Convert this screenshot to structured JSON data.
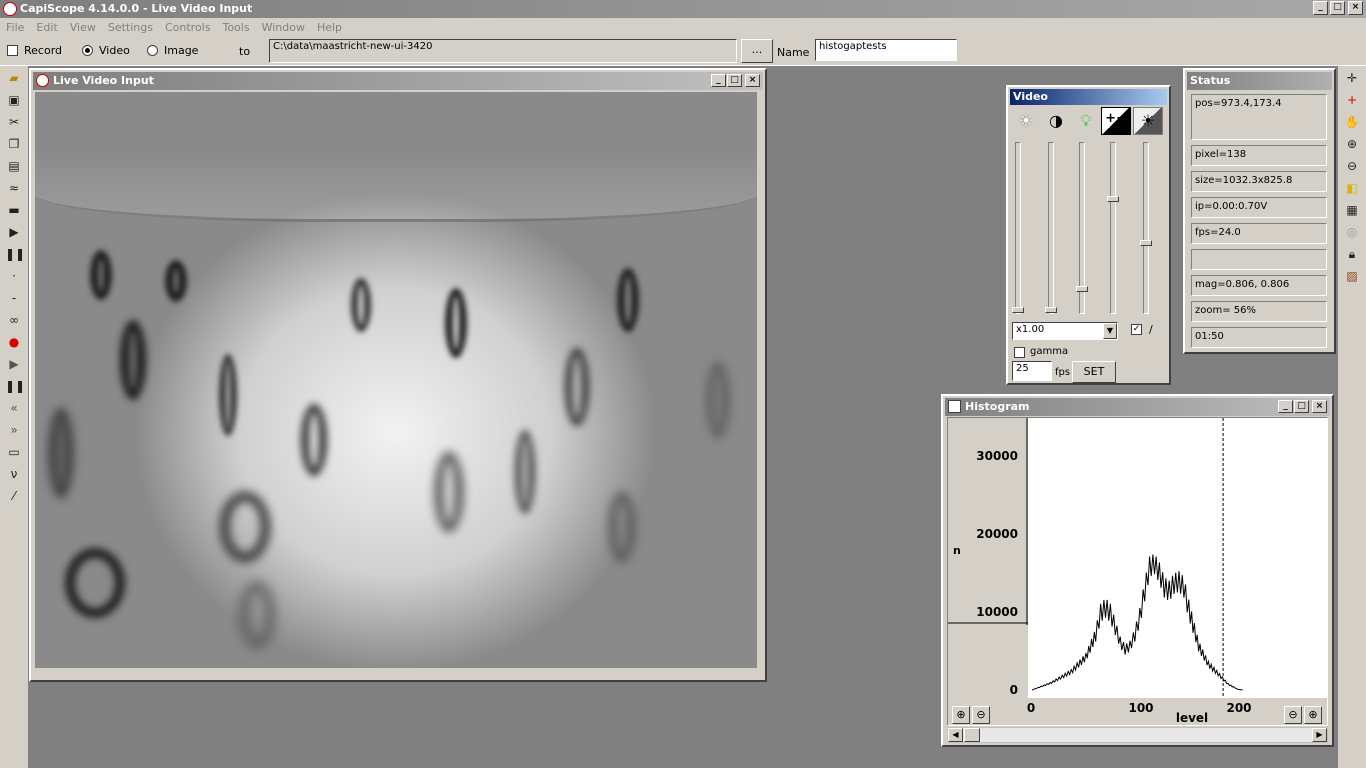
{
  "app": {
    "title": "CapiScope 4.14.0.0 - Live Video Input",
    "logo_icon": "capiscope-logo-icon"
  },
  "menu": [
    "File",
    "Edit",
    "View",
    "Settings",
    "Controls",
    "Tools",
    "Window",
    "Help"
  ],
  "options": {
    "record_label": "Record",
    "video_label": "Video",
    "image_label": "Image",
    "to_label": "to",
    "path_value": "C:\\data\\maastricht-new-ui-3420",
    "browse_label": "...",
    "name_label": "Name",
    "name_value": "histogaptests"
  },
  "video_window": {
    "title": "Live Video Input"
  },
  "video_panel": {
    "title": "Video",
    "gain_value": "x1.00",
    "checkbox_label": "/",
    "gamma_label": "gamma",
    "fps_value": "25",
    "fps_label": "fps",
    "set_label": "SET",
    "slider_levels": [
      0.0,
      0.0,
      0.15,
      0.65,
      0.4
    ]
  },
  "status": {
    "title": "Status",
    "pos": "pos=973.4,173.4",
    "pixel": "pixel=138",
    "size": "size=1032.3x825.8",
    "ip": "ip=0.00:0.70V",
    "fps": "fps=24.0",
    "blank": "",
    "mag": "mag=0.806, 0.806",
    "zoom": "zoom=  56%",
    "time": "01:50"
  },
  "histogram": {
    "title": "Histogram",
    "y_ticks": [
      "30000",
      "20000",
      "10000",
      "0"
    ],
    "x_ticks": [
      "0",
      "100",
      "200"
    ],
    "xlabel": "level",
    "ylabel": "n"
  },
  "chart_data": {
    "type": "line",
    "xlabel": "level",
    "ylabel": "n",
    "xlim": [
      0,
      300
    ],
    "ylim": [
      0,
      35000
    ],
    "marker_x": 195,
    "x": [
      0,
      20,
      40,
      55,
      65,
      70,
      75,
      80,
      85,
      90,
      95,
      100,
      105,
      110,
      115,
      120,
      125,
      130,
      135,
      140,
      145,
      150,
      155,
      160,
      170,
      180,
      190,
      200,
      210,
      215
    ],
    "y": [
      0,
      1000,
      2500,
      4500,
      7500,
      10500,
      11200,
      10500,
      8500,
      6500,
      5500,
      6000,
      7500,
      10000,
      13500,
      16800,
      17200,
      16000,
      14000,
      13500,
      14500,
      14800,
      14000,
      11000,
      6000,
      3500,
      2200,
      800,
      100,
      0
    ]
  }
}
